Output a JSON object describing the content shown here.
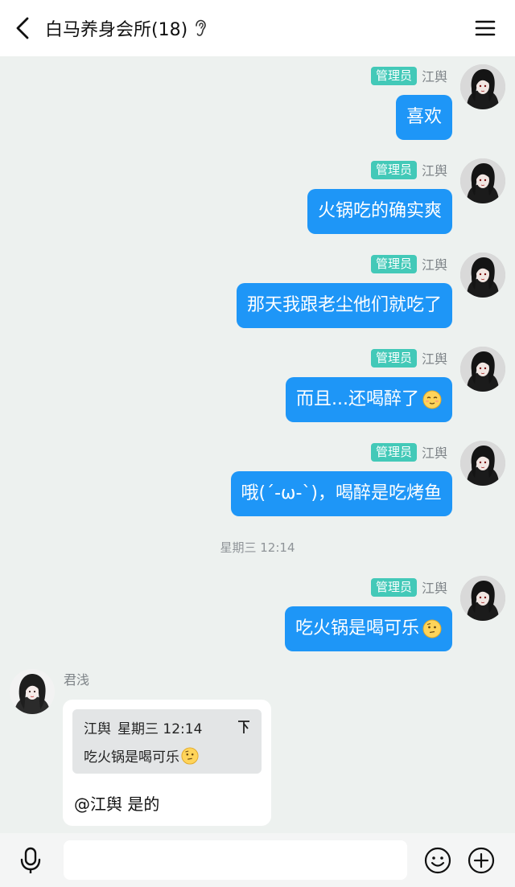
{
  "header": {
    "title": "白马养身会所(18)",
    "icons": {
      "back": "back-arrow-icon",
      "ear": "ear-icon",
      "menu": "menu-icon"
    }
  },
  "colors": {
    "bubble_out": "#1e96f7",
    "role_badge": "#43c9b8",
    "background": "#edf1ef"
  },
  "messages": [
    {
      "role": "管理员",
      "name": "江舆",
      "text": "喜欢"
    },
    {
      "role": "管理员",
      "name": "江舆",
      "text": "火锅吃的确实爽"
    },
    {
      "role": "管理员",
      "name": "江舆",
      "text": "那天我跟老尘他们就吃了"
    },
    {
      "role": "管理员",
      "name": "江舆",
      "text": "而且...还喝醉了",
      "emoji": "relieved-face-icon"
    },
    {
      "role": "管理员",
      "name": "江舆",
      "text": "哦(´-ω-`)，喝醉是吃烤鱼"
    },
    {
      "role": "管理员",
      "name": "江舆",
      "text": "吃火锅是喝可乐",
      "emoji": "thinking-face-icon"
    }
  ],
  "time_divider": "星期三 12:14",
  "incoming": {
    "name": "君浅",
    "quote_name": "江舆",
    "quote_time": "星期三 12:14",
    "quote_text": "吃火锅是喝可乐",
    "quote_emoji": "thinking-face-icon",
    "reply": "@江舆 是的"
  },
  "inputbar": {
    "placeholder": "",
    "icons": {
      "mic": "microphone-icon",
      "emoji": "emoji-face-icon",
      "plus": "plus-circle-icon"
    }
  }
}
